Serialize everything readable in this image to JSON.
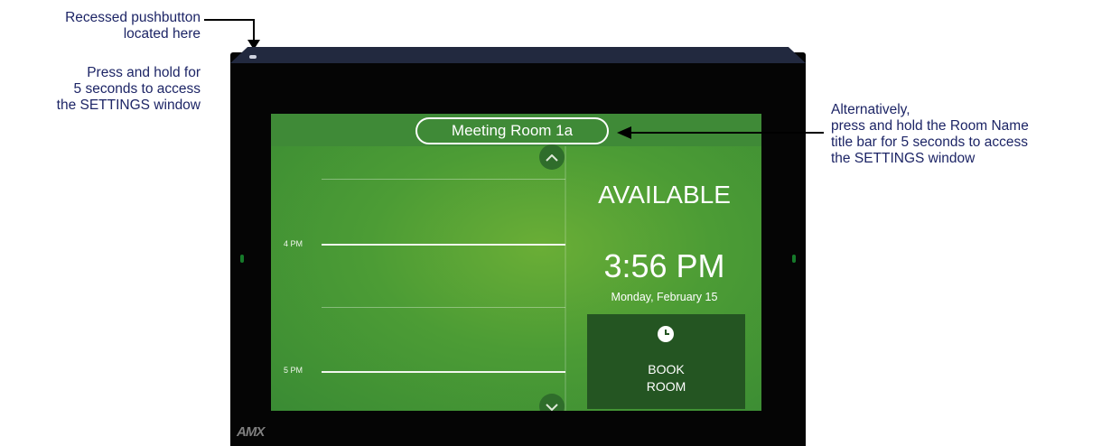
{
  "annotations": {
    "pushbutton_title": [
      "Recessed pushbutton",
      "located here"
    ],
    "pushbutton_desc": [
      "Press and hold for",
      "5 seconds to access",
      "the SETTINGS window"
    ],
    "titlebar_desc": [
      "Alternatively,",
      "press and hold the Room Name",
      "title bar for 5 seconds to access",
      "the SETTINGS window"
    ]
  },
  "device": {
    "logo": "AMX"
  },
  "screen": {
    "room_name": "Meeting Room 1a",
    "status": "AVAILABLE",
    "time": "3:56 PM",
    "date": "Monday, February 15",
    "hour_labels": [
      "4 PM",
      "5 PM"
    ],
    "book_button": [
      "BOOK",
      "ROOM"
    ],
    "icons": {
      "clock": "clock-icon",
      "scroll_up": "chevron-up-icon",
      "scroll_down": "chevron-down-icon"
    }
  },
  "colors": {
    "annotation_text": "#1d2566",
    "screen_green": "#4c9c35",
    "book_button_bg": "#245522"
  }
}
